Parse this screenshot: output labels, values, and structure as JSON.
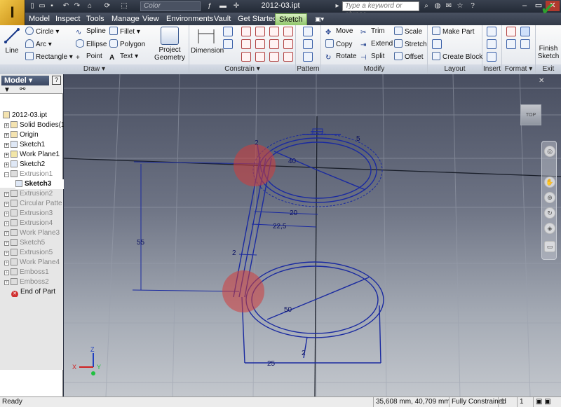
{
  "app": {
    "logo_glyph": "I",
    "document_title": "2012-03.ipt",
    "color_combo": "Color",
    "search_placeholder": "Type a keyword or phrase"
  },
  "tabs": [
    {
      "label": "Model"
    },
    {
      "label": "Inspect"
    },
    {
      "label": "Tools"
    },
    {
      "label": "Manage"
    },
    {
      "label": "View"
    },
    {
      "label": "Environments"
    },
    {
      "label": "Vault"
    },
    {
      "label": "Get Started"
    },
    {
      "label": "Sketch"
    }
  ],
  "ribbon": {
    "draw": {
      "label": "Draw",
      "line": "Line",
      "circle": "Circle",
      "arc": "Arc",
      "rectangle": "Rectangle",
      "spline": "Spline",
      "ellipse": "Ellipse",
      "point": "Point",
      "fillet": "Fillet",
      "polygon": "Polygon",
      "text": "Text",
      "project_geometry_1": "Project",
      "project_geometry_2": "Geometry"
    },
    "constrain": {
      "label": "Constrain",
      "dimension": "Dimension"
    },
    "pattern": {
      "label": "Pattern"
    },
    "modify": {
      "label": "Modify",
      "move": "Move",
      "copy": "Copy",
      "rotate": "Rotate",
      "trim": "Trim",
      "extend": "Extend",
      "split": "Split",
      "scale": "Scale",
      "stretch": "Stretch",
      "offset": "Offset"
    },
    "layout": {
      "label": "Layout",
      "make_part": "Make Part",
      "create_block": "Create Block"
    },
    "insert": {
      "label": "Insert"
    },
    "format": {
      "label": "Format"
    },
    "exit": {
      "label": "Exit",
      "finish_1": "Finish",
      "finish_2": "Sketch"
    }
  },
  "browser": {
    "title": "Model",
    "items": [
      {
        "label": "2012-03.ipt"
      },
      {
        "label": "Solid Bodies(1"
      },
      {
        "label": "Origin"
      },
      {
        "label": "Sketch1"
      },
      {
        "label": "Work Plane1"
      },
      {
        "label": "Sketch2"
      },
      {
        "label": "Extrusion1"
      },
      {
        "label": "Sketch3"
      },
      {
        "label": "Extrusion2"
      },
      {
        "label": "Circular Patte"
      },
      {
        "label": "Extrusion3"
      },
      {
        "label": "Extrusion4"
      },
      {
        "label": "Work Plane3"
      },
      {
        "label": "Sketch5"
      },
      {
        "label": "Extrusion5"
      },
      {
        "label": "Work Plane4"
      },
      {
        "label": "Emboss1"
      },
      {
        "label": "Emboss2"
      },
      {
        "label": "End of Part"
      }
    ]
  },
  "sketch": {
    "dimensions": {
      "top_left": "2",
      "top_right": "5",
      "top_circle": "40",
      "d20": "20",
      "d22_5": "22,5",
      "height": "55",
      "wall": "2",
      "bottom_circle": "50",
      "bottom_small": "2",
      "bottom_width": "25"
    },
    "axes": {
      "x": "X",
      "y": "Y",
      "z": "Z"
    },
    "viewcube_label": "TOP"
  },
  "status": {
    "left": "Ready",
    "coordinates": "35,608 mm, 40,709 mm",
    "constraint": "Fully Constrained",
    "count1": "1",
    "count2": "1"
  }
}
